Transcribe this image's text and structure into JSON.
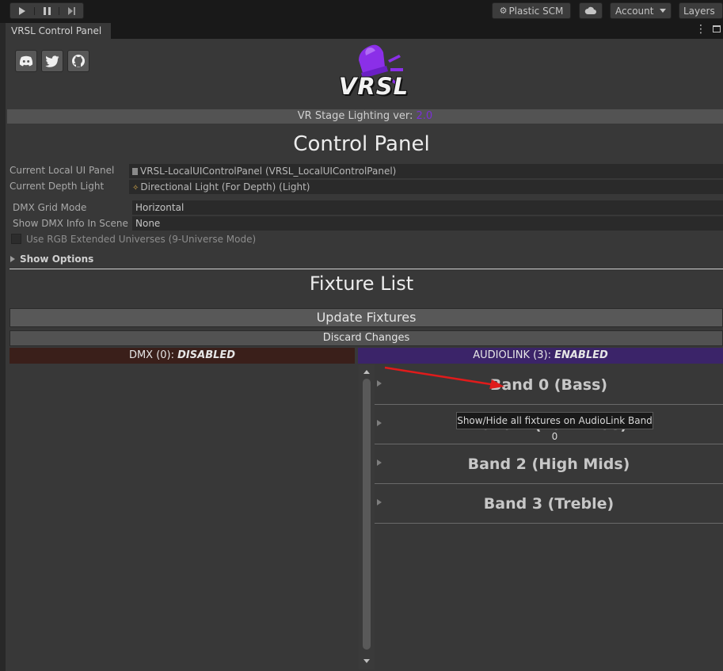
{
  "toolbar": {
    "plastic_scm": "Plastic SCM",
    "account": "Account",
    "layers": "Layers"
  },
  "window": {
    "tab_title": "VRSL Control Panel"
  },
  "logo": {
    "text": "VRSL"
  },
  "version": {
    "prefix": "VR Stage Lighting ver: ",
    "number": "2.0"
  },
  "control_panel": {
    "title": "Control Panel",
    "current_local_ui_panel_label": "Current Local UI Panel",
    "current_local_ui_panel_value": "VRSL-LocalUIControlPanel (VRSL_LocalUIControlPanel)",
    "current_depth_light_label": "Current Depth Light",
    "current_depth_light_value": "Directional Light (For Depth) (Light)",
    "dmx_grid_mode_label": "DMX Grid Mode",
    "dmx_grid_mode_value": "Horizontal",
    "show_dmx_info_label": "Show DMX Info In Scene",
    "show_dmx_info_value": "None",
    "rgb_extended_label": "Use RGB Extended Universes (9-Universe Mode)",
    "show_options": "Show Options"
  },
  "fixture_list": {
    "title": "Fixture List",
    "update_button": "Update Fixtures",
    "discard_button": "Discard Changes",
    "dmx_header": "DMX (0): ",
    "dmx_status": "DISABLED",
    "audiolink_header": "AUDIOLINK (3): ",
    "audiolink_status": "ENABLED",
    "bands": [
      "Band 0 (Bass)",
      "Band 1 (Low Mids)",
      "Band 2 (High Mids)",
      "Band 3 (Treble)"
    ],
    "tooltip": "Show/Hide all fixtures on AudioLink Band 0"
  },
  "colors": {
    "version_accent": "#7b2fd6",
    "dmx_header_bg": "#3a1f1a",
    "audiolink_header_bg": "#3b2469",
    "arrow": "#e01b1b"
  }
}
